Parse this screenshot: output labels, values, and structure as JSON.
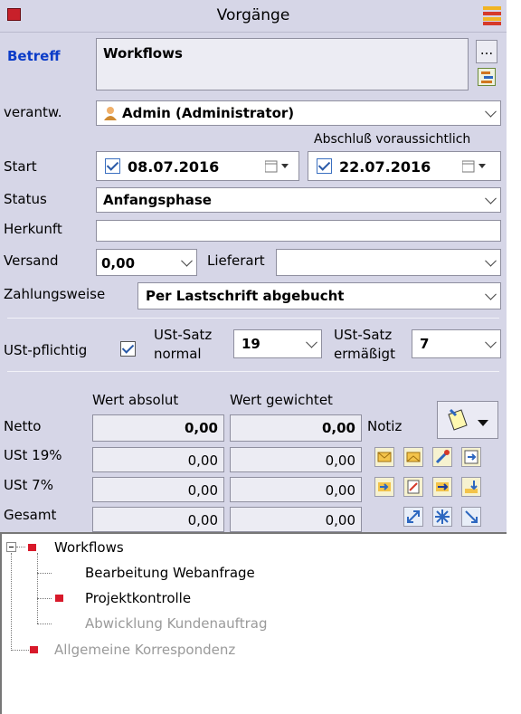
{
  "window": {
    "title": "Vorgänge"
  },
  "fields": {
    "betreff_label": "Betreff",
    "betreff_value": "Workflows",
    "betreff_more": "...",
    "verantw_label": "verantw.",
    "verantw_value": "Admin (Administrator)",
    "abschluss_label": "Abschluß voraussichtlich",
    "start_label": "Start",
    "start_date": "08.07.2016",
    "end_date": "22.07.2016",
    "status_label": "Status",
    "status_value": "Anfangsphase",
    "herkunft_label": "Herkunft",
    "herkunft_value": "",
    "versand_label": "Versand",
    "versand_value": "0,00",
    "lieferart_label": "Lieferart",
    "lieferart_value": "",
    "zahlung_label": "Zahlungsweise",
    "zahlung_value": "Per Lastschrift abgebucht",
    "ust_label": "USt-pflichtig",
    "ust_normal_label1": "USt-Satz",
    "ust_normal_label2": "normal",
    "ust_normal_value": "19",
    "ust_erm_label1": "USt-Satz",
    "ust_erm_label2": "ermäßigt",
    "ust_erm_value": "7"
  },
  "values": {
    "col_abs": "Wert absolut",
    "col_gew": "Wert gewichtet",
    "notiz": "Notiz",
    "rows": [
      {
        "label": "Netto",
        "abs": "0,00",
        "gew": "0,00"
      },
      {
        "label": "USt 19%",
        "abs": "0,00",
        "gew": "0,00"
      },
      {
        "label": "USt  7%",
        "abs": "0,00",
        "gew": "0,00"
      },
      {
        "label": "Gesamt",
        "abs": "0,00",
        "gew": "0,00"
      }
    ]
  },
  "tree": {
    "root": "Workflows",
    "children": [
      "Bearbeitung Webanfrage",
      "Projektkontrolle",
      "Abwicklung Kundenauftrag"
    ],
    "sibling": "Allgemeine Korrespondenz"
  },
  "colors": {
    "accent_blue": "#0b3cc8",
    "marker_red": "#d8192a",
    "disabled_text": "#9a9a9a"
  },
  "icons": [
    "window-icon",
    "list-menu-icon",
    "browse-icon",
    "person-icon",
    "calendar-icon",
    "note-icon",
    "toolbar-icons"
  ]
}
